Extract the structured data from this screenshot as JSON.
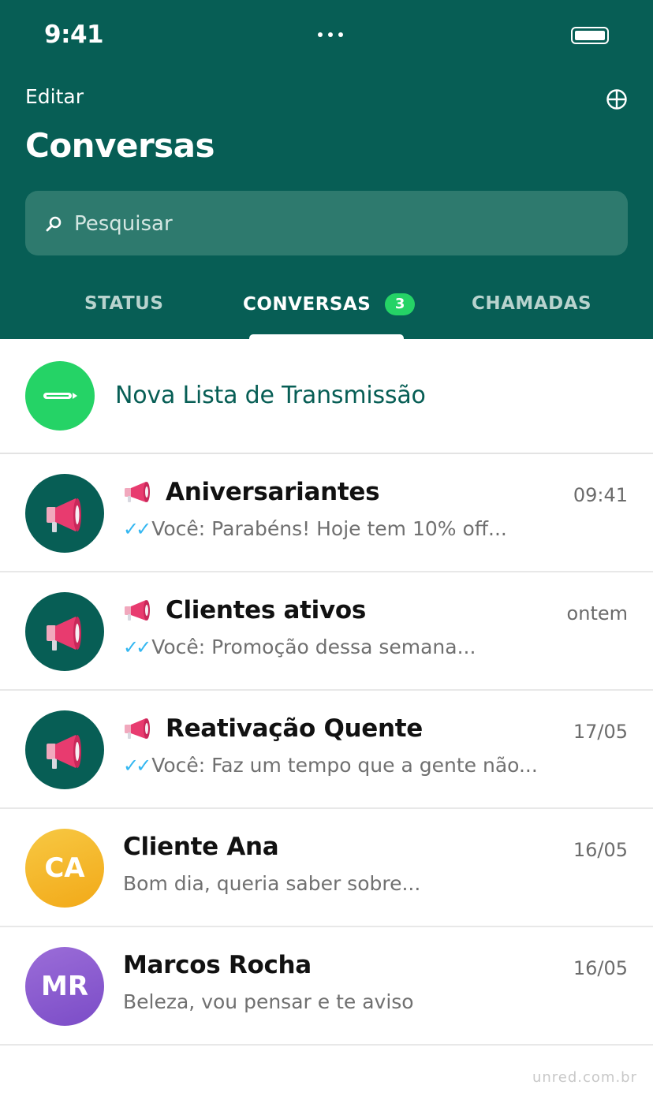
{
  "status_bar": {
    "time": "9:41"
  },
  "header": {
    "edit_label": "Editar",
    "title": "Conversas",
    "search_placeholder": "Pesquisar",
    "compose_icon": "compose-icon",
    "colors": {
      "header_bg": "#075e55",
      "accent": "#25d366"
    }
  },
  "tabs": [
    {
      "label": "STATUS",
      "active": false
    },
    {
      "label": "CONVERSAS",
      "active": true,
      "badge": "3"
    },
    {
      "label": "CHAMADAS",
      "active": false
    }
  ],
  "new_broadcast": {
    "label": "Nova Lista de Transmissão"
  },
  "chats": [
    {
      "name": "Aniversariantes",
      "time": "09:41",
      "ticks": "✓✓",
      "preview": "Você: Parabéns! Hoje tem 10% off...",
      "type": "broadcast"
    },
    {
      "name": "Clientes ativos",
      "time": "ontem",
      "ticks": "✓✓",
      "preview": "Você: Promoção dessa semana...",
      "type": "broadcast"
    },
    {
      "name": "Reativação Quente",
      "time": "17/05",
      "ticks": "✓✓",
      "preview": "Você: Faz um tempo que a gente não...",
      "type": "broadcast"
    },
    {
      "name": "Cliente Ana",
      "time": "16/05",
      "initials": "CA",
      "preview": "Bom dia, queria saber sobre...",
      "type": "contact"
    },
    {
      "name": "Marcos Rocha",
      "time": "16/05",
      "initials": "MR",
      "preview": "Beleza, vou pensar e te aviso",
      "type": "contact"
    }
  ],
  "watermark": "unred.com.br"
}
